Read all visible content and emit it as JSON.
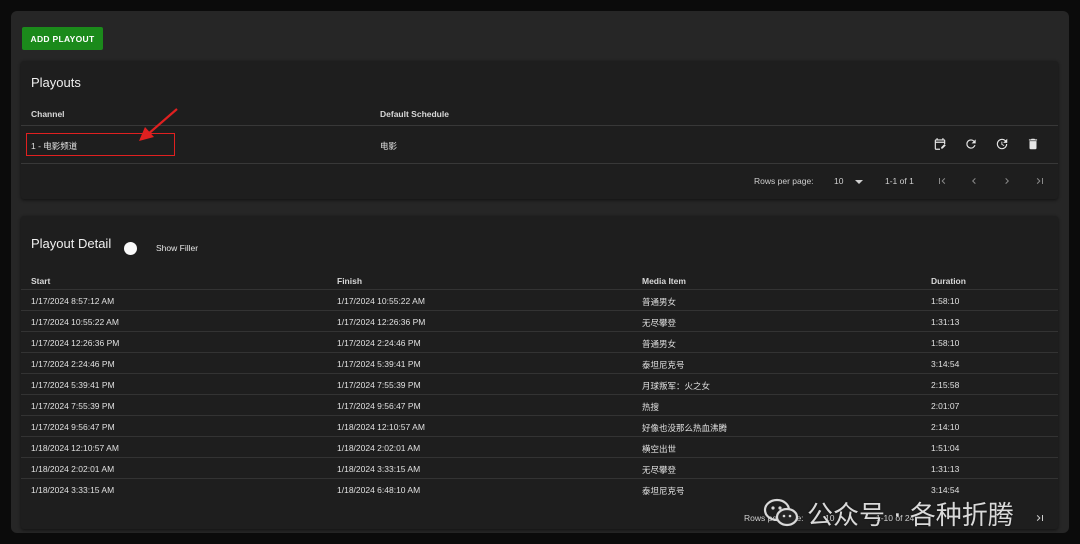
{
  "toolbar": {
    "add_label": "ADD PLAYOUT"
  },
  "playouts": {
    "title": "Playouts",
    "columns": {
      "channel": "Channel",
      "schedule": "Default Schedule"
    },
    "row": {
      "channel": "1 - 电影频道",
      "schedule": "电影"
    },
    "actions": [
      "calendar-edit-icon",
      "refresh-icon",
      "reset-clock-icon",
      "delete-icon"
    ],
    "pagination": {
      "rows_label": "Rows per page:",
      "rows_value": "10",
      "range": "1-1 of 1"
    }
  },
  "detail": {
    "title": "Playout Detail",
    "filler_label": "Show Filler",
    "columns": {
      "start": "Start",
      "finish": "Finish",
      "media": "Media Item",
      "duration": "Duration"
    },
    "rows": [
      {
        "start": "1/17/2024 8:57:12 AM",
        "finish": "1/17/2024 10:55:22 AM",
        "media": "普通男女",
        "duration": "1:58:10"
      },
      {
        "start": "1/17/2024 10:55:22 AM",
        "finish": "1/17/2024 12:26:36 PM",
        "media": "无尽攀登",
        "duration": "1:31:13"
      },
      {
        "start": "1/17/2024 12:26:36 PM",
        "finish": "1/17/2024 2:24:46 PM",
        "media": "普通男女",
        "duration": "1:58:10"
      },
      {
        "start": "1/17/2024 2:24:46 PM",
        "finish": "1/17/2024 5:39:41 PM",
        "media": "泰坦尼克号",
        "duration": "3:14:54"
      },
      {
        "start": "1/17/2024 5:39:41 PM",
        "finish": "1/17/2024 7:55:39 PM",
        "media": "月球叛军：火之女",
        "duration": "2:15:58"
      },
      {
        "start": "1/17/2024 7:55:39 PM",
        "finish": "1/17/2024 9:56:47 PM",
        "media": "热搜",
        "duration": "2:01:07"
      },
      {
        "start": "1/17/2024 9:56:47 PM",
        "finish": "1/18/2024 12:10:57 AM",
        "media": "好像也没那么热血沸腾",
        "duration": "2:14:10"
      },
      {
        "start": "1/18/2024 12:10:57 AM",
        "finish": "1/18/2024 2:02:01 AM",
        "media": "横空出世",
        "duration": "1:51:04"
      },
      {
        "start": "1/18/2024 2:02:01 AM",
        "finish": "1/18/2024 3:33:15 AM",
        "media": "无尽攀登",
        "duration": "1:31:13"
      },
      {
        "start": "1/18/2024 3:33:15 AM",
        "finish": "1/18/2024 6:48:10 AM",
        "media": "泰坦尼克号",
        "duration": "3:14:54"
      }
    ],
    "pagination": {
      "rows_label": "Rows per page:",
      "rows_value": "10",
      "range": "1-10 of 24"
    }
  },
  "watermark": {
    "text": "公众号 · 各种折腾"
  },
  "colors": {
    "accent": "#1b8a1b",
    "highlight": "#e02020",
    "card": "#1e1e1e",
    "background": "#262626"
  }
}
